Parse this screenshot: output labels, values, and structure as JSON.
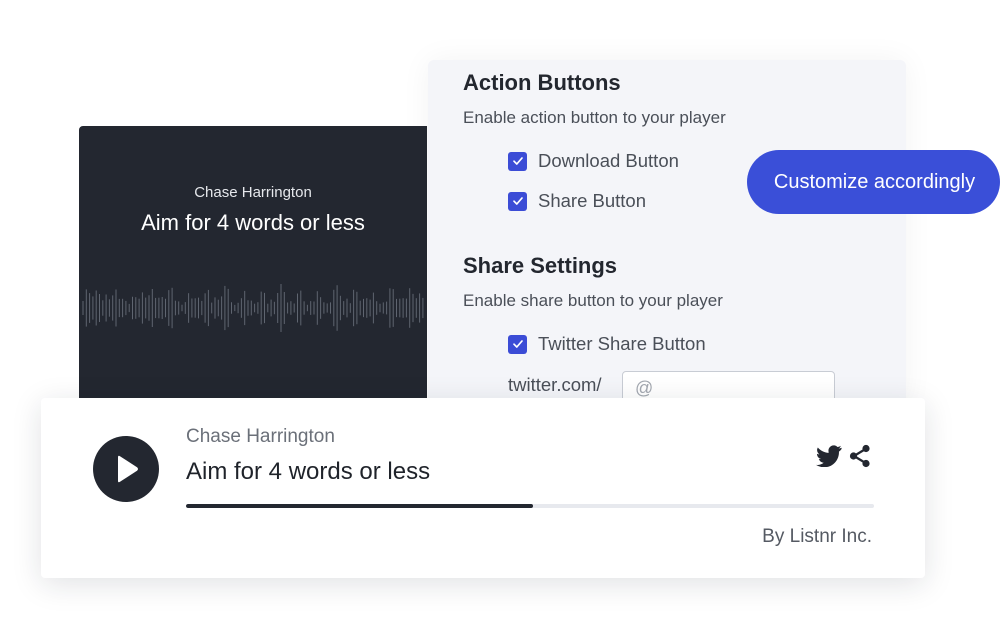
{
  "settings": {
    "action_title": "Action Buttons",
    "action_desc": "Enable action button to your player",
    "download_label": "Download Button",
    "share_label": "Share Button",
    "share_title": "Share Settings",
    "share_desc": "Enable share button to your player",
    "twitter_label": "Twitter Share Button",
    "twitter_prefix": "twitter.com/",
    "twitter_placeholder": "@",
    "download_checked": true,
    "share_checked": true,
    "twitter_checked": true
  },
  "cover": {
    "author": "Chase Harrington",
    "title": "Aim for 4 words or less"
  },
  "pill": {
    "label": "Customize accordingly"
  },
  "player": {
    "author": "Chase Harrington",
    "title": "Aim for 4 words or less",
    "progress": 0.505,
    "credit": "By Listnr Inc."
  },
  "colors": {
    "accent": "#3a4fd8",
    "dark": "#232730",
    "panel": "#f4f5f9"
  },
  "icons": [
    "check-icon",
    "play-icon",
    "twitter-icon",
    "share-icon"
  ]
}
